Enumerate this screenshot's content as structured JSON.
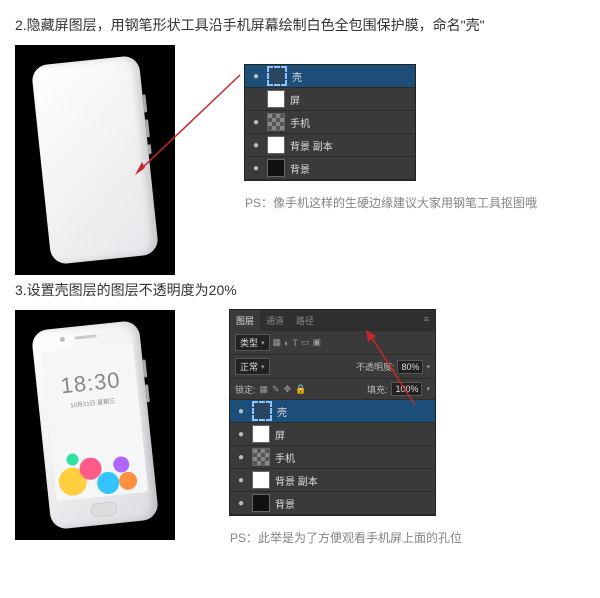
{
  "step2": {
    "title": "2.隐藏屏图层，用钢笔形状工具沿手机屏幕绘制白色全包围保护膜，命名\"壳\"",
    "layers": [
      {
        "eye": "●",
        "thumb": "sel",
        "name": "壳",
        "selected": true
      },
      {
        "eye": "",
        "thumb": "white",
        "name": "屏"
      },
      {
        "eye": "●",
        "thumb": "check",
        "name": "手机"
      },
      {
        "eye": "●",
        "thumb": "white",
        "name": "背景 副本"
      },
      {
        "eye": "●",
        "thumb": "black",
        "name": "背景"
      }
    ],
    "note": "PS：像手机这样的生硬边缘建议大家用钢笔工具抠图哦"
  },
  "step3": {
    "title": "3.设置壳图层的图层不透明度为20%",
    "tabs": [
      "图层",
      "通道",
      "路径"
    ],
    "kind_label": "类型",
    "blend_label": "正常",
    "opacity_label": "不透明度:",
    "opacity_value": "80%",
    "lock_label": "锁定:",
    "fill_label": "填充:",
    "fill_value": "100%",
    "layers": [
      {
        "eye": "●",
        "thumb": "sel",
        "name": "壳",
        "selected": true
      },
      {
        "eye": "●",
        "thumb": "white",
        "name": "屏"
      },
      {
        "eye": "●",
        "thumb": "check",
        "name": "手机"
      },
      {
        "eye": "●",
        "thumb": "white",
        "name": "背景 副本"
      },
      {
        "eye": "●",
        "thumb": "black",
        "name": "背景"
      }
    ],
    "note": "PS：此举是为了方便观看手机屏上面的孔位",
    "phone": {
      "time": "18:30",
      "date": "10月21日 星期三"
    }
  }
}
